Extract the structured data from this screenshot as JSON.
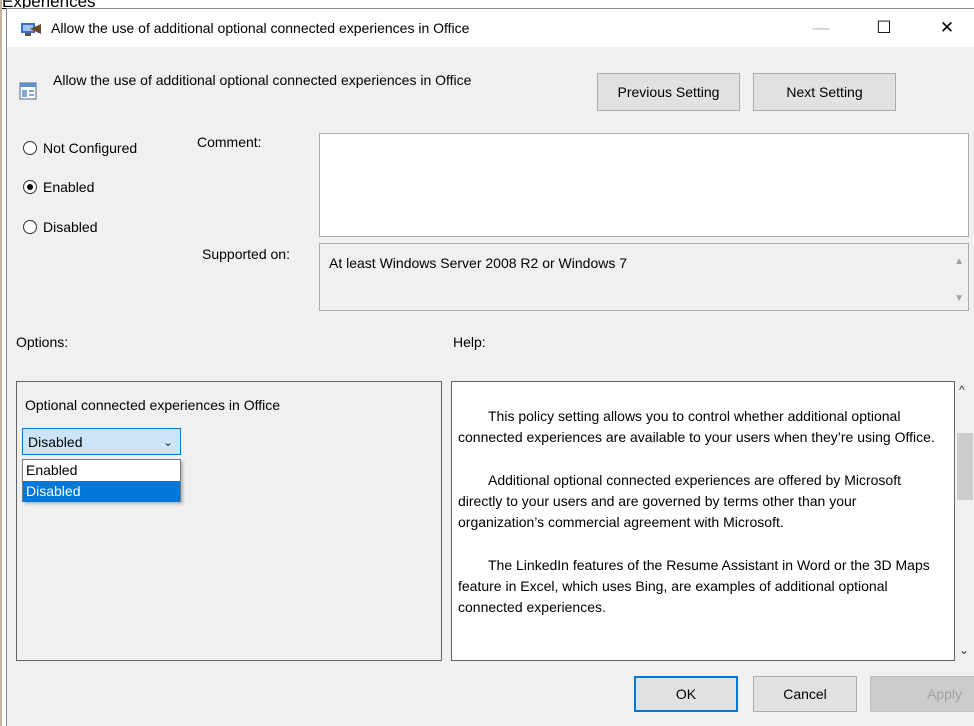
{
  "background": {
    "link_text": "Experiences"
  },
  "window": {
    "title": "Allow the use of additional optional connected experiences in Office",
    "minimize_glyph": "—",
    "maximize_glyph": "☐",
    "close_glyph": "✕"
  },
  "header": {
    "policy_title": "Allow the use of additional optional connected experiences in Office",
    "previous_label": "Previous Setting",
    "next_label": "Next Setting"
  },
  "state": {
    "options": [
      {
        "label": "Not Configured",
        "checked": false
      },
      {
        "label": "Enabled",
        "checked": true
      },
      {
        "label": "Disabled",
        "checked": false
      }
    ]
  },
  "comment": {
    "label": "Comment:",
    "value": ""
  },
  "supported": {
    "label": "Supported on:",
    "value": "At least Windows Server 2008 R2 or Windows 7"
  },
  "options_section": {
    "label": "Options:",
    "field_label": "Optional connected experiences in Office",
    "selected": "Disabled",
    "dropdown_options": [
      "Enabled",
      "Disabled"
    ],
    "highlighted_option": "Disabled"
  },
  "help_section": {
    "label": "Help:",
    "paragraphs": [
      "This policy setting allows you to control whether additional optional connected experiences are available to your users when they’re using Office.",
      "Additional optional connected experiences are offered by Microsoft directly to your users and are governed by terms other than your organization’s commercial agreement with Microsoft.",
      "The LinkedIn features of the Resume Assistant in Word or the 3D Maps feature in Excel, which uses Bing, are examples of additional optional connected experiences."
    ]
  },
  "footer": {
    "ok_label": "OK",
    "cancel_label": "Cancel",
    "apply_label": "Apply"
  },
  "colors": {
    "accent": "#0078d7",
    "dialog_bg": "#f0f0f0",
    "selection_bg": "#cce4f7"
  }
}
